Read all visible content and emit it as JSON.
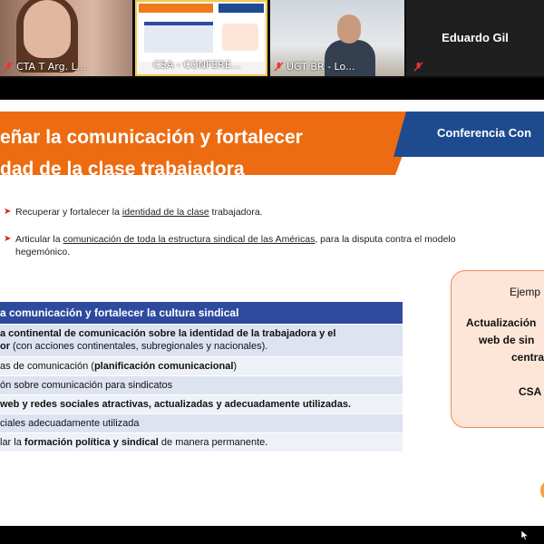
{
  "participants": [
    {
      "name": "CTA T Arg. L..."
    },
    {
      "name": "CSA - CONFERE..."
    },
    {
      "name": "UGT BR - Lo..."
    },
    {
      "name": "Eduardo Gil"
    }
  ],
  "slide": {
    "title_line1": "eñar la comunicación y fortalecer",
    "title_line2": "dad de la clase trabajadora",
    "banner_right": "Conferencia Con",
    "bullet1": {
      "pre": "Recuperar y fortalecer la ",
      "link": "identidad de la clase",
      "post": " trabajadora."
    },
    "bullet2": {
      "pre": "Articular la ",
      "link": "comunicación de toda la estructura sindical de las Américas",
      "post": ", para la disputa contra el modelo",
      "line2": "hegemónico."
    },
    "table": {
      "header": "a comunicación y fortalecer la cultura sindical",
      "row1_bold": "a continental de comunicación sobre la identidad de la trabajadora y el",
      "row1_bold2": "or",
      "row1_rest": " (con acciones continentales, subregionales y nacionales).",
      "row2_pre": "as de comunicación (",
      "row2_bold": "planificación comunicacional",
      "row2_post": ")",
      "row3": "ón sobre comunicación para sindicatos",
      "row4": "web y redes sociales atractivas, actualizadas y adecuadamente utilizadas.",
      "row5": "ciales adecuadamente utilizada",
      "row6_pre": "lar la ",
      "row6_bold": "formación política y sindical",
      "row6_post": " de manera permanente."
    },
    "example": {
      "line0": "Ejemp",
      "line1": "Actualización",
      "line2": "web de sin",
      "line3": "centra",
      "line4": "CSA"
    }
  },
  "colors": {
    "orange": "#ed6c12",
    "blue": "#1e4b8f",
    "table_header": "#2e4a9e",
    "example_bg": "#fde6d8"
  }
}
